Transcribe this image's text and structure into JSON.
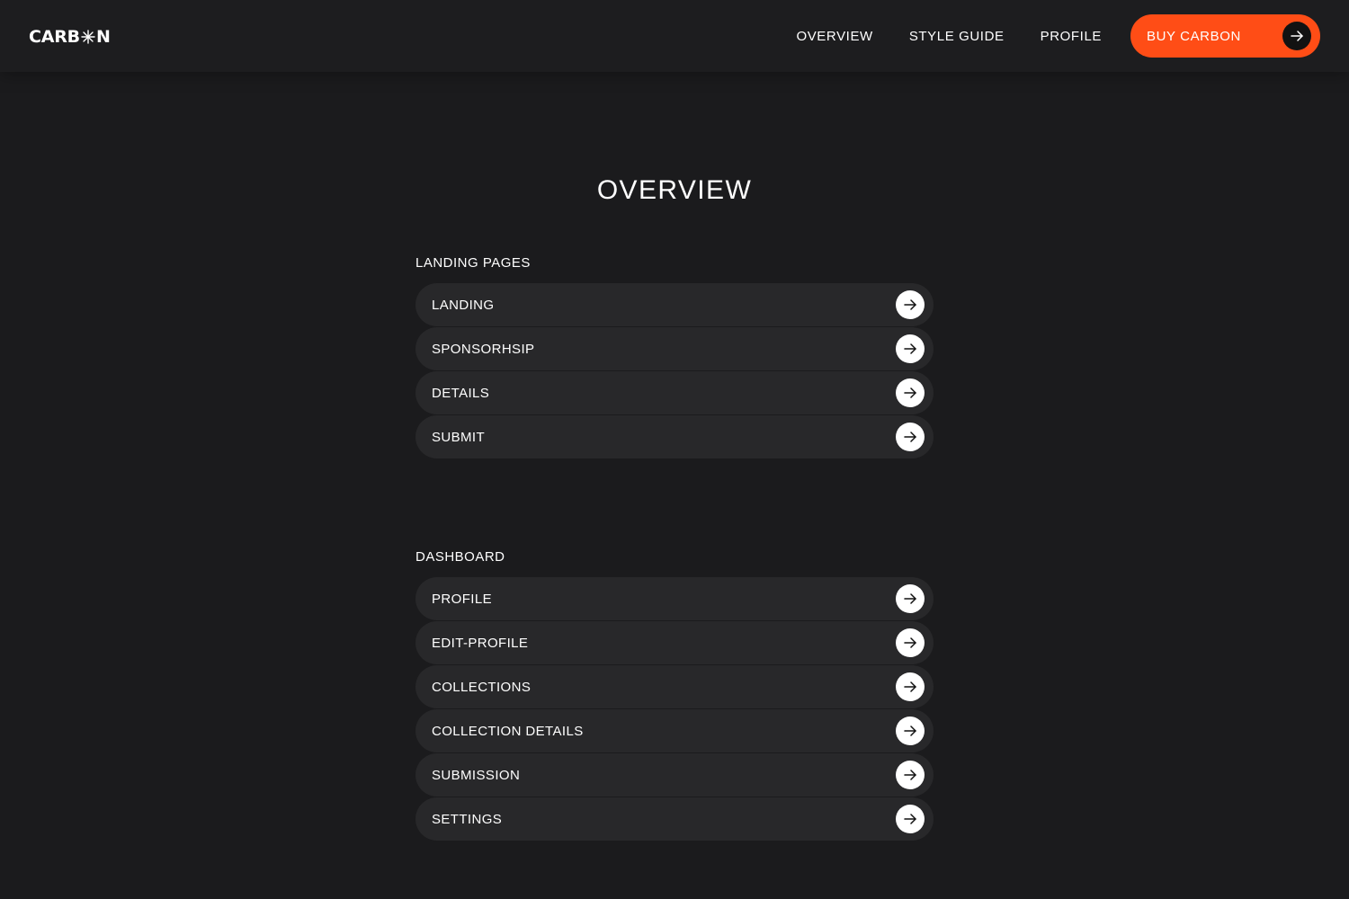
{
  "header": {
    "logo": {
      "pre": "CARB",
      "post": "N"
    },
    "nav": [
      {
        "label": "OVERVIEW"
      },
      {
        "label": "STYLE GUIDE"
      },
      {
        "label": "PROFILE"
      }
    ],
    "cta_label": "BUY CARBON",
    "cta_color": "#ff4d16"
  },
  "main": {
    "title": "OVERVIEW",
    "sections": [
      {
        "title": "LANDING PAGES",
        "items": [
          {
            "label": "LANDING"
          },
          {
            "label": "SPONSORHSIP"
          },
          {
            "label": "DETAILS"
          },
          {
            "label": "SUBMIT"
          }
        ]
      },
      {
        "title": "DASHBOARD",
        "items": [
          {
            "label": "PROFILE"
          },
          {
            "label": "EDIT-PROFILE"
          },
          {
            "label": "COLLECTIONS"
          },
          {
            "label": "COLLECTION DETAILS"
          },
          {
            "label": "SUBMISSION"
          },
          {
            "label": "SETTINGS"
          }
        ]
      }
    ]
  },
  "icons": {
    "logo_star": "asterisk-icon",
    "row_arrow": "arrow-right-icon"
  },
  "colors": {
    "background": "#1b1b1d",
    "row_background": "#28282a",
    "accent": "#ff4d16"
  }
}
